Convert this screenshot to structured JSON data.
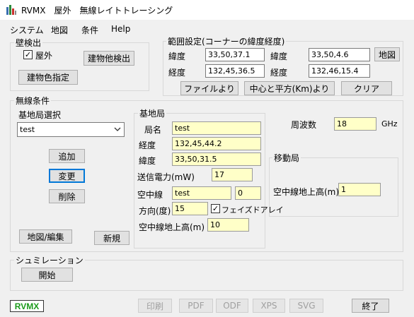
{
  "window": {
    "title": "RVMX　屋外　無線レイトトレーシング"
  },
  "menu": [
    "システム",
    "地図",
    "条件",
    "Help"
  ],
  "wall_detection": {
    "title": "壁検出",
    "outdoor_checkbox": {
      "label": "屋外",
      "checked": true,
      "mark": "✓"
    },
    "detect_buildings_button": "建物他検出",
    "building_color_button": "建物色指定"
  },
  "range": {
    "title": "範囲設定(コーナーの緯度経度)",
    "lat_label_1": "緯度",
    "lat_value_1": "33,50,37.1",
    "lat_label_2": "緯度",
    "lat_value_2": "33,50,4.6",
    "map_button": "地図",
    "lon_label_1": "経度",
    "lon_value_1": "132,45,36.5",
    "lon_label_2": "経度",
    "lon_value_2": "132,46,15.4",
    "from_file_button": "ファイルより",
    "center_square_button": "中心と平方(Km)より",
    "clear_button": "クリア"
  },
  "radio": {
    "title": "無線条件",
    "station_select_label": "基地局選択",
    "station_select_value": "test",
    "add_button": "追加",
    "change_button": "変更",
    "delete_button": "削除",
    "map_edit_button": "地図/編集",
    "new_button": "新規",
    "frequency_label": "周波数",
    "frequency_value": "18",
    "frequency_unit": "GHz"
  },
  "base_station": {
    "title": "基地局",
    "name_label": "局名",
    "name_value": "test",
    "lon_label": "経度",
    "lon_value": "132,45,44.2",
    "lat_label": "緯度",
    "lat_value": "33,50,31.5",
    "power_label": "送信電力(mW)",
    "power_value": "17",
    "antenna_label": "空中線",
    "antenna_value": "test",
    "antenna_index": "0",
    "direction_label": "方向(度)",
    "direction_value": "15",
    "phased_array_label": "フェイズドアレイ",
    "phased_array_checked": true,
    "height_label": "空中線地上高(m)",
    "height_value": "10"
  },
  "mobile_station": {
    "title": "移動局",
    "height_label": "空中線地上高(m)",
    "height_value": "1"
  },
  "simulation": {
    "title": "シュミレーション",
    "start_button": "開始"
  },
  "footer": {
    "badge": "RVMX",
    "print_button": "印刷",
    "pdf_button": "PDF",
    "odf_button": "ODF",
    "xps_button": "XPS",
    "svg_button": "SVG",
    "exit_button": "終了"
  },
  "colors": {
    "input_yellow": "#ffffc8",
    "badge_green": "#1a9a1a",
    "focus_blue": "#0078d7"
  }
}
